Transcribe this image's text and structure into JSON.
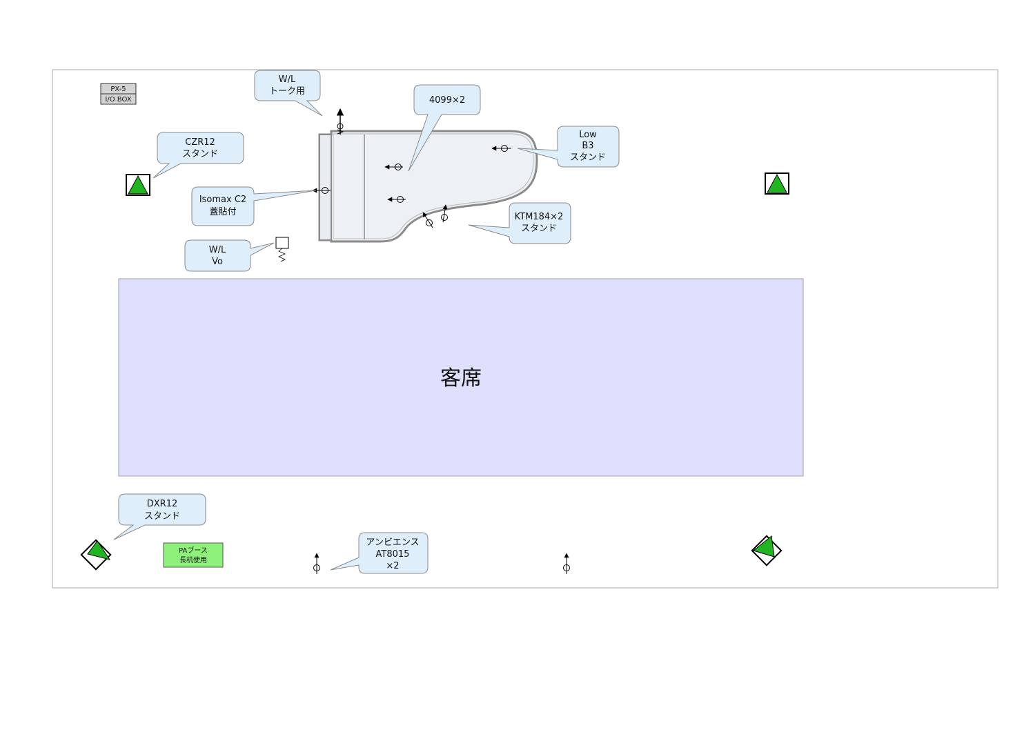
{
  "audience": {
    "label": "客席"
  },
  "equipment": {
    "px5_line1": "PX-5",
    "px5_line2": "I/O BOX",
    "pa_line1": "PAブース",
    "pa_line2": "長机使用"
  },
  "callouts": {
    "wl_talk": {
      "line1": "W/L",
      "line2": "トーク用"
    },
    "mic4099": {
      "line1": "4099×2"
    },
    "czr12": {
      "line1": "CZR12",
      "line2": "スタンド"
    },
    "low_b3": {
      "line1": "Low",
      "line2": "B3",
      "line3": "スタンド"
    },
    "isomax": {
      "line1": "Isomax C2",
      "line2": "蓋貼付"
    },
    "ktm184": {
      "line1": "KTM184×2",
      "line2": "スタンド"
    },
    "wl_vo": {
      "line1": "W/L",
      "line2": "Vo"
    },
    "dxr12": {
      "line1": "DXR12",
      "line2": "スタンド"
    },
    "ambience": {
      "line1": "アンビエンス",
      "line2": "AT8015",
      "line3": "×2"
    }
  },
  "colors": {
    "audience_fill": "#dfe0fd",
    "callout_fill": "#deeefb",
    "speaker_green": "#22b522",
    "pa_green": "#8ef27a",
    "px5_gray": "#d4d4d4",
    "piano_fill": "#edf1f6"
  }
}
